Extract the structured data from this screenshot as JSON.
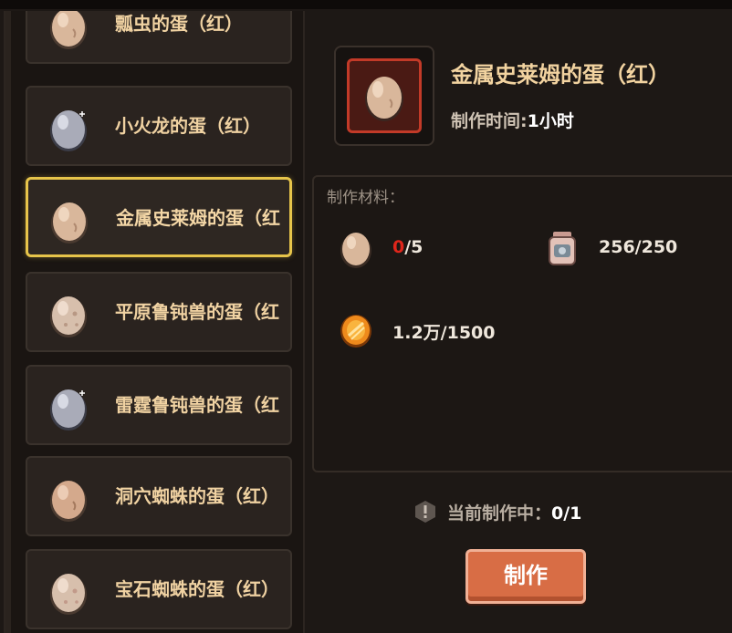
{
  "recipes": [
    {
      "label": "瓢虫的蛋（红）",
      "egg": "tan-egg"
    },
    {
      "label": "小火龙的蛋（红）",
      "egg": "silver-egg"
    },
    {
      "label": "金属史莱姆的蛋（红",
      "egg": "tan-egg"
    },
    {
      "label": "平原鲁钝兽的蛋（红",
      "egg": "spotted-egg"
    },
    {
      "label": "雷霆鲁钝兽的蛋（红",
      "egg": "silver-egg"
    },
    {
      "label": "洞穴蜘蛛的蛋（红）",
      "egg": "tan-egg"
    },
    {
      "label": "宝石蜘蛛的蛋（红）",
      "egg": "spotted-egg"
    }
  ],
  "selected_index": 2,
  "detail": {
    "title": "金属史莱姆的蛋（红）",
    "time_label": "制作时间:",
    "time_value": "1小时",
    "frame_color": "#c23a28"
  },
  "materials": {
    "title": "制作材料：",
    "items": [
      {
        "icon": "egg-icon",
        "have": "0",
        "need": "/5",
        "lacking": true
      },
      {
        "icon": "jar-icon",
        "have": "256",
        "need": "/250",
        "lacking": false
      },
      {
        "icon": "coin-icon",
        "have": "1.2万",
        "need": "/1500",
        "lacking": false
      }
    ]
  },
  "status": {
    "label": "当前制作中：",
    "value": "0/1"
  },
  "craft_button": {
    "label": "制作"
  },
  "colors": {
    "accent_gold": "#e6c44a",
    "button": "#d86d45",
    "lack_red": "#e0261b"
  }
}
